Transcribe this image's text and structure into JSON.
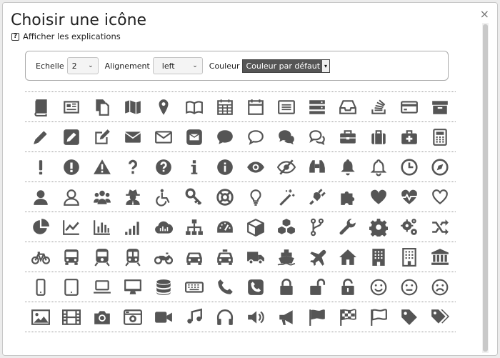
{
  "dialog": {
    "title": "Choisir une icône",
    "close": "×",
    "help_icon": "?",
    "help_link": "Afficher les explications"
  },
  "options": {
    "scale_label": "Echelle",
    "scale_value": "2",
    "align_label": "Alignement",
    "align_value": "left",
    "color_label": "Couleur",
    "color_value": "Couleur par défaut"
  },
  "icon_color": "#555555",
  "icon_rows": [
    [
      "book-icon",
      "newspaper-icon",
      "files-icon",
      "map-icon",
      "map-marker-icon",
      "open-book-icon",
      "calendar-icon",
      "calendar-empty-icon",
      "list-alt-icon",
      "server-icon",
      "inbox-icon",
      "stack-icon",
      "credit-card-icon",
      "archive-icon"
    ],
    [
      "pencil-icon",
      "pencil-square-icon",
      "edit-icon",
      "envelope-icon",
      "envelope-outline-icon",
      "envelope-square-icon",
      "comment-icon",
      "comment-outline-icon",
      "comments-icon",
      "comments-outline-icon",
      "briefcase-icon",
      "suitcase-icon",
      "medkit-icon",
      "calculator-icon"
    ],
    [
      "exclamation-icon",
      "exclamation-circle-icon",
      "warning-icon",
      "question-icon",
      "question-circle-icon",
      "info-icon",
      "info-circle-icon",
      "eye-icon",
      "eye-slash-icon",
      "binoculars-icon",
      "bell-icon",
      "bell-outline-icon",
      "clock-icon",
      "compass-icon"
    ],
    [
      "user-icon",
      "user-outline-icon",
      "users-icon",
      "user-secret-icon",
      "wheelchair-icon",
      "key-icon",
      "life-ring-icon",
      "lightbulb-icon",
      "magic-icon",
      "plug-icon",
      "puzzle-icon",
      "heart-icon",
      "heartbeat-icon",
      "heart-outline-icon"
    ],
    [
      "pie-chart-icon",
      "line-chart-icon",
      "bar-chart-icon",
      "signal-icon",
      "cloud-icon",
      "sitemap-icon",
      "dashboard-icon",
      "cube-icon",
      "cubes-icon",
      "code-fork-icon",
      "wrench-icon",
      "cog-icon",
      "cogs-icon",
      "random-icon"
    ],
    [
      "bicycle-icon",
      "bus-icon",
      "train-icon",
      "subway-icon",
      "motorcycle-icon",
      "car-icon",
      "taxi-icon",
      "truck-icon",
      "ship-icon",
      "plane-icon",
      "home-icon",
      "building-icon",
      "building-outline-icon",
      "bank-icon"
    ],
    [
      "mobile-icon",
      "tablet-icon",
      "laptop-icon",
      "desktop-icon",
      "database-icon",
      "keyboard-icon",
      "phone-icon",
      "phone-square-icon",
      "lock-icon",
      "unlock-icon",
      "unlock-alt-icon",
      "smile-icon",
      "meh-icon",
      "frown-icon"
    ],
    [
      "image-icon",
      "film-icon",
      "camera-icon",
      "camera-retro-icon",
      "video-camera-icon",
      "music-icon",
      "headphones-icon",
      "volume-up-icon",
      "bullhorn-icon",
      "flag-icon",
      "flag-checkered-icon",
      "flag-outline-icon",
      "tag-icon",
      "tags-icon"
    ]
  ]
}
